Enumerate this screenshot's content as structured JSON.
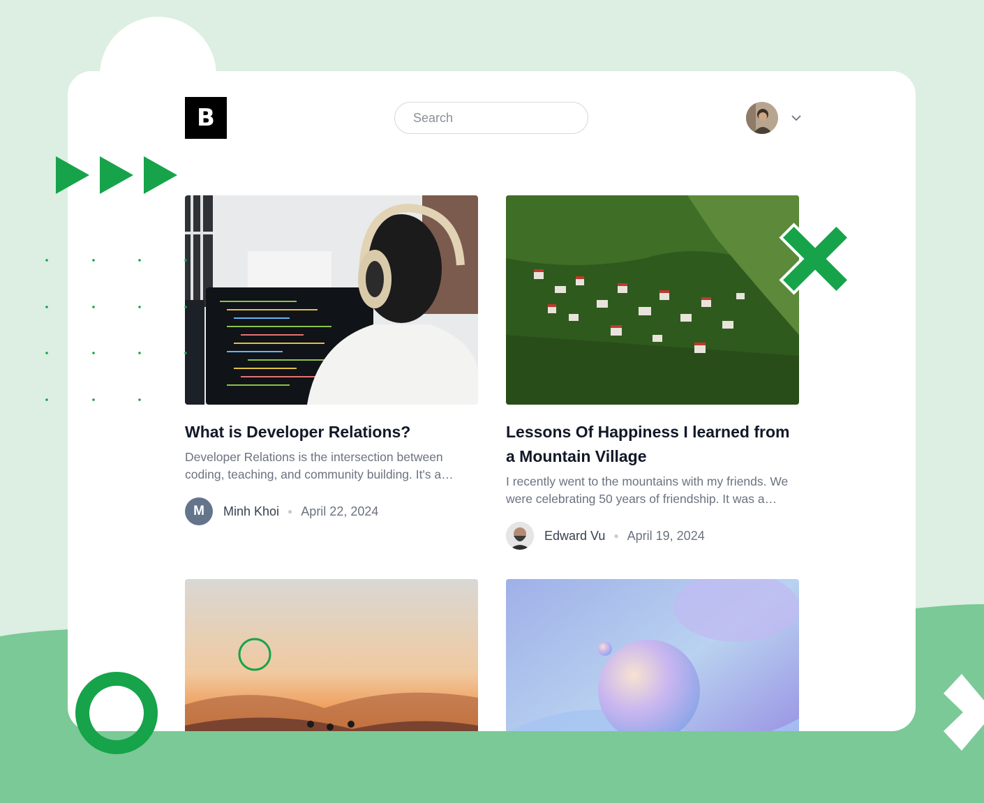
{
  "header": {
    "logo_letter": "B",
    "search_placeholder": "Search",
    "search_icon": "search-icon",
    "avatar_icon": "user-avatar",
    "menu_icon": "chevron-down-icon"
  },
  "posts": [
    {
      "title": "What is Developer Relations?",
      "excerpt": "Developer Relations is the intersection between coding, teaching, and community building. It's a fascinating role that combines technical skills with people skills.",
      "author": "Minh Khoi",
      "author_initial": "M",
      "date": "April 22, 2024",
      "image": "developer-at-computer"
    },
    {
      "title": "Lessons Of Happiness I learned from a Mountain Village",
      "excerpt": "I recently went to the mountains with my friends. We were celebrating 50 years of friendship. It was a wonderful trip.",
      "author": "Edward Vu",
      "date": "April 19, 2024",
      "image": "mountain-village"
    },
    {
      "image": "sunset-hikers"
    },
    {
      "image": "abstract-spheres"
    }
  ],
  "colors": {
    "accent_green": "#16a34a",
    "background_mint": "#dcefe2",
    "ground_green": "#7bc996",
    "author_avatar_bg": "#64748b"
  }
}
